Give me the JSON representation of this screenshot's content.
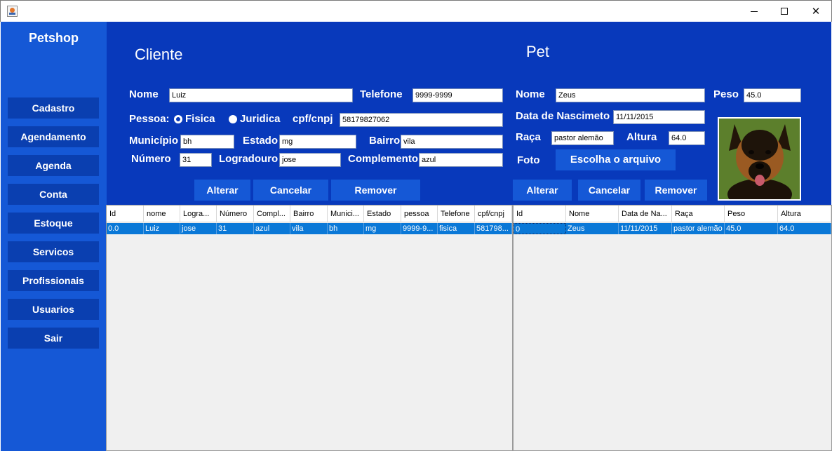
{
  "window": {
    "minimize": "—",
    "maximize": "☐",
    "close": "✕"
  },
  "sidebar": {
    "brand": "Petshop",
    "items": [
      "Cadastro",
      "Agendamento",
      "Agenda",
      "Conta",
      "Estoque",
      "Servicos",
      "Profissionais",
      "Usuarios",
      "Sair"
    ]
  },
  "cliente": {
    "title": "Cliente",
    "nome_label": "Nome",
    "nome": "Luiz",
    "telefone_label": "Telefone",
    "telefone": "9999-9999",
    "pessoa_label": "Pessoa:",
    "fisica_label": "Fisica",
    "juridica_label": "Juridica",
    "cpf_label": "cpf/cnpj",
    "cpf": "58179827062",
    "municipio_label": "Município",
    "municipio": "bh",
    "estado_label": "Estado",
    "estado": "mg",
    "bairro_label": "Bairro",
    "bairro": "vila",
    "numero_label": "Número",
    "numero": "31",
    "logradouro_label": "Logradouro",
    "logradouro": "jose",
    "complemento_label": "Complemento",
    "complemento": "azul",
    "buttons": {
      "alterar": "Alterar",
      "cancelar": "Cancelar",
      "remover": "Remover"
    }
  },
  "pet": {
    "title": "Pet",
    "nome_label": "Nome",
    "nome": "Zeus",
    "peso_label": "Peso",
    "peso": "45.0",
    "nascimento_label": "Data de Nascimeto",
    "nascimento": "11/11/2015",
    "raca_label": "Raça",
    "raca": "pastor alemão",
    "altura_label": "Altura",
    "altura": "64.0",
    "foto_label": "Foto",
    "foto_button": "Escolha o arquivo",
    "buttons": {
      "alterar": "Alterar",
      "cancelar": "Cancelar",
      "remover": "Remover"
    }
  },
  "clientes_table": {
    "headers": [
      "Id",
      "nome",
      "Logra...",
      "Número",
      "Compl...",
      "Bairro",
      "Munici...",
      "Estado",
      "pessoa",
      "Telefone",
      "cpf/cnpj"
    ],
    "rows": [
      [
        "0.0",
        "Luiz",
        "jose",
        "31",
        "azul",
        "vila",
        "bh",
        "mg",
        "9999-9...",
        "fisica",
        "581798..."
      ]
    ]
  },
  "pets_table": {
    "headers": [
      "Id",
      "Nome",
      "Data de Na...",
      "Raça",
      "Peso",
      "Altura"
    ],
    "rows": [
      [
        "0",
        "Zeus",
        "11/11/2015",
        "pastor alemão",
        "45.0",
        "64.0"
      ]
    ]
  },
  "colors": {
    "sidebar": "#1558d6",
    "panel": "#0839bb",
    "button": "#0a3fb0",
    "selection": "#0a78d7"
  }
}
